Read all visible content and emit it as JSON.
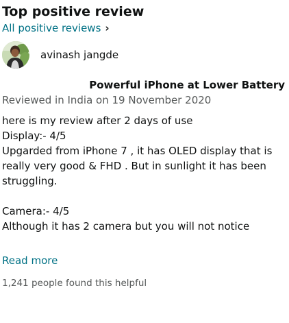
{
  "section": {
    "heading": "Top positive review",
    "all_reviews_link": "All positive reviews",
    "chevron": "›"
  },
  "review": {
    "reviewer_name": "avinash jangde",
    "title": "Powerful iPhone at Lower Battery",
    "date_line": "Reviewed in India on 19 November 2020",
    "body_lines": [
      "here is my review after 2 days of use",
      "Display:- 4/5",
      "Upgarded from iPhone 7 , it has OLED display that is really very good & FHD . But in sunlight it has been struggling.",
      "",
      "Camera:- 4/5",
      "Although it has 2 camera but you will not notice"
    ],
    "read_more": "Read more",
    "helpful_text": "1,241 people found this helpful"
  },
  "colors": {
    "link": "#007185",
    "text": "#0f1111",
    "secondary": "#565959"
  },
  "icons": {
    "avatar": "reviewer-avatar-photo",
    "chevron": "chevron-right-icon"
  }
}
